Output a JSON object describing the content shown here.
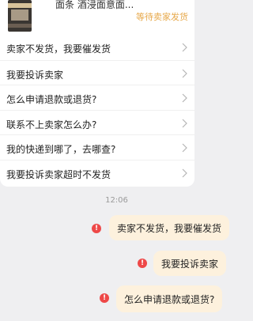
{
  "order": {
    "title": "面条 酒浸面意面...",
    "status": "等待卖家发货"
  },
  "questions": [
    {
      "label": "卖家不发货，我要催发货"
    },
    {
      "label": "我要投诉卖家"
    },
    {
      "label": "怎么申请退款或退货?"
    },
    {
      "label": "联系不上卖家怎么办?"
    },
    {
      "label": "我的快递到哪了，去哪查?"
    },
    {
      "label": "我要投诉卖家超时不发货"
    }
  ],
  "timestamp": "12:06",
  "messages": [
    {
      "text": "卖家不发货，我要催发货",
      "status_icon": "!"
    },
    {
      "text": "我要投诉卖家",
      "status_icon": "!"
    },
    {
      "text": "怎么申请退款或退货?",
      "status_icon": "!"
    }
  ],
  "colors": {
    "background": "#efeff1",
    "accent": "#e7a84a",
    "bubble": "#fdf1dd",
    "error": "#ee4848"
  }
}
